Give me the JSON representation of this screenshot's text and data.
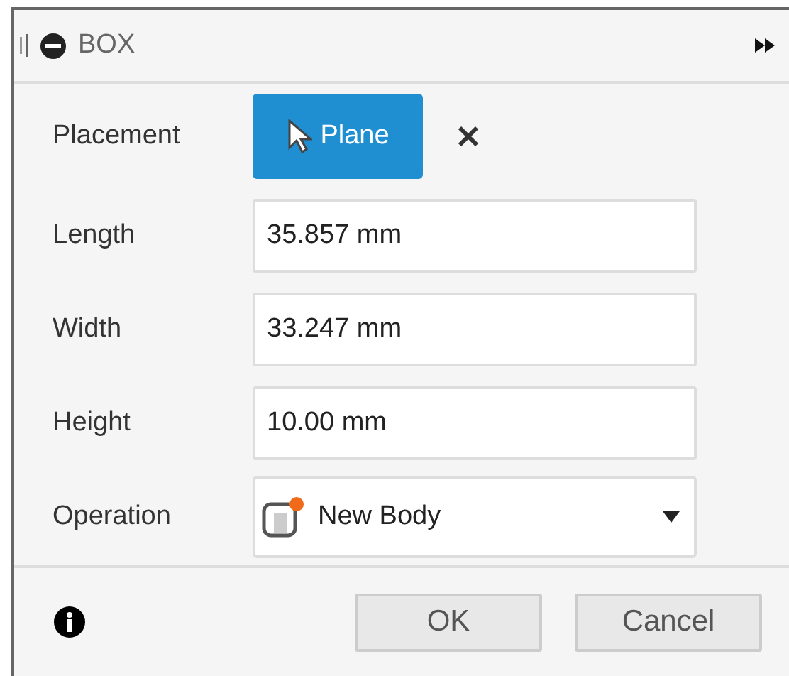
{
  "dialog": {
    "title": "BOX",
    "collapsed": false
  },
  "placement": {
    "label": "Placement",
    "button": "Plane",
    "selected": true
  },
  "fields": [
    {
      "kind": "text",
      "label": "Length",
      "value": "35.857 mm"
    },
    {
      "kind": "text",
      "label": "Width",
      "value": "33.247 mm"
    },
    {
      "kind": "text",
      "label": "Height",
      "value": "10.00 mm"
    },
    {
      "kind": "select",
      "label": "Operation",
      "value": "New Body"
    }
  ],
  "buttons": [
    "OK",
    "Cancel"
  ]
}
